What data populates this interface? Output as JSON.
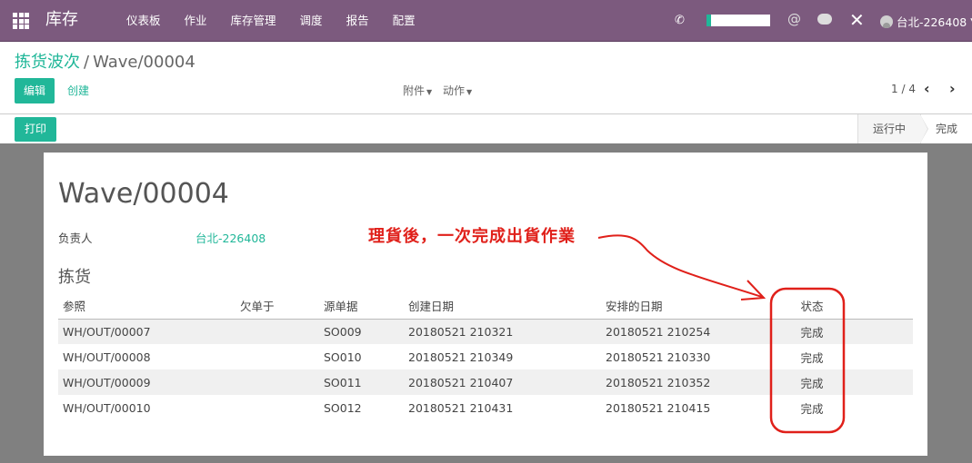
{
  "navbar": {
    "brand": "库存",
    "menu": [
      "仪表板",
      "作业",
      "库存管理",
      "调度",
      "报告",
      "配置"
    ],
    "user": "台北-226408"
  },
  "breadcrumb": {
    "parent": "拣货波次",
    "current": "Wave/00004"
  },
  "buttons": {
    "edit": "编辑",
    "create": "创建",
    "attachment": "附件",
    "action": "动作",
    "print": "打印"
  },
  "pager": {
    "value": "1 / 4"
  },
  "stages": {
    "running": "运行中",
    "done": "完成"
  },
  "sheet": {
    "title": "Wave/00004",
    "responsible_label": "负责人",
    "responsible_value": "台北-226408",
    "section": "拣货",
    "annotation": "理貨後，一次完成出貨作業"
  },
  "table": {
    "headers": [
      "参照",
      "欠单于",
      "源单据",
      "创建日期",
      "安排的日期",
      "状态"
    ],
    "rows": [
      [
        "WH/OUT/00007",
        "",
        "SO009",
        "20180521 210321",
        "20180521 210254",
        "完成"
      ],
      [
        "WH/OUT/00008",
        "",
        "SO010",
        "20180521 210349",
        "20180521 210330",
        "完成"
      ],
      [
        "WH/OUT/00009",
        "",
        "SO011",
        "20180521 210407",
        "20180521 210352",
        "完成"
      ],
      [
        "WH/OUT/00010",
        "",
        "SO012",
        "20180521 210431",
        "20180521 210415",
        "完成"
      ]
    ]
  },
  "colors": {
    "navbar": "#7c5a7e",
    "accent": "#21b799",
    "annotation": "#e0201a"
  },
  "icons": [
    "apps-grid-icon",
    "phone-icon",
    "at-icon",
    "chat-icon",
    "close-icon",
    "user-avatar-icon",
    "chevron-left-icon",
    "chevron-right-icon"
  ]
}
